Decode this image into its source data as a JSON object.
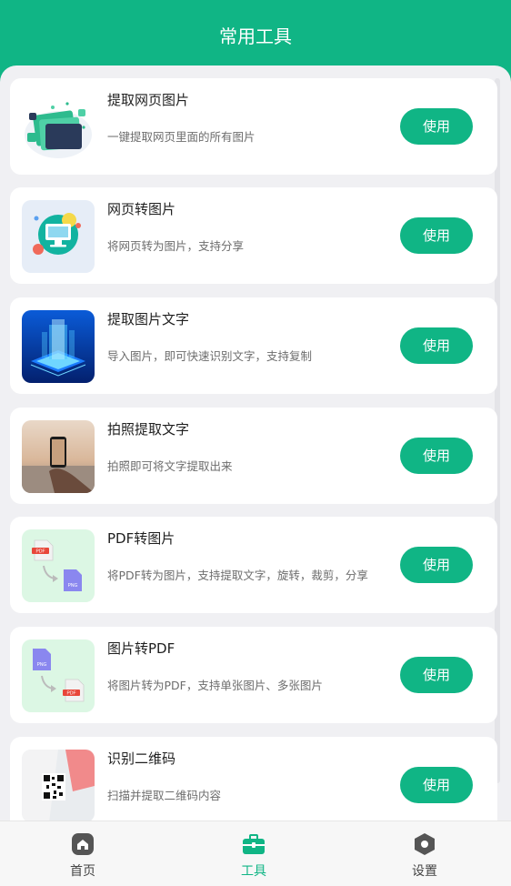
{
  "header": {
    "title": "常用工具"
  },
  "tools": [
    {
      "title": "提取网页图片",
      "description": "一键提取网页里面的所有图片",
      "button_label": "使用",
      "icon": "web-image-extract-icon"
    },
    {
      "title": "网页转图片",
      "description": "将网页转为图片，支持分享",
      "button_label": "使用",
      "icon": "web-to-image-icon"
    },
    {
      "title": "提取图片文字",
      "description": "导入图片，即可快速识别文字，支持复制",
      "button_label": "使用",
      "icon": "ai-chip-icon"
    },
    {
      "title": "拍照提取文字",
      "description": "拍照即可将文字提取出来",
      "button_label": "使用",
      "icon": "phone-camera-photo"
    },
    {
      "title": "PDF转图片",
      "description": "将PDF转为图片，支持提取文字，旋转，裁剪，分享",
      "button_label": "使用",
      "icon": "pdf-to-png-icon",
      "thumb_labels": [
        "PDF",
        "PNG"
      ]
    },
    {
      "title": "图片转PDF",
      "description": "将图片转为PDF，支持单张图片、多张图片",
      "button_label": "使用",
      "icon": "png-to-pdf-icon",
      "thumb_labels": [
        "PNG",
        "PDF"
      ]
    },
    {
      "title": "识别二维码",
      "description": "扫描并提取二维码内容",
      "button_label": "使用",
      "icon": "qr-code-icon"
    }
  ],
  "tabbar": {
    "items": [
      {
        "label": "首页",
        "icon": "home-icon",
        "active": false
      },
      {
        "label": "工具",
        "icon": "toolbox-icon",
        "active": true
      },
      {
        "label": "设置",
        "icon": "settings-hex-icon",
        "active": false
      }
    ]
  },
  "colors": {
    "accent": "#10b585",
    "background": "#f0f0f3",
    "card": "#ffffff"
  }
}
